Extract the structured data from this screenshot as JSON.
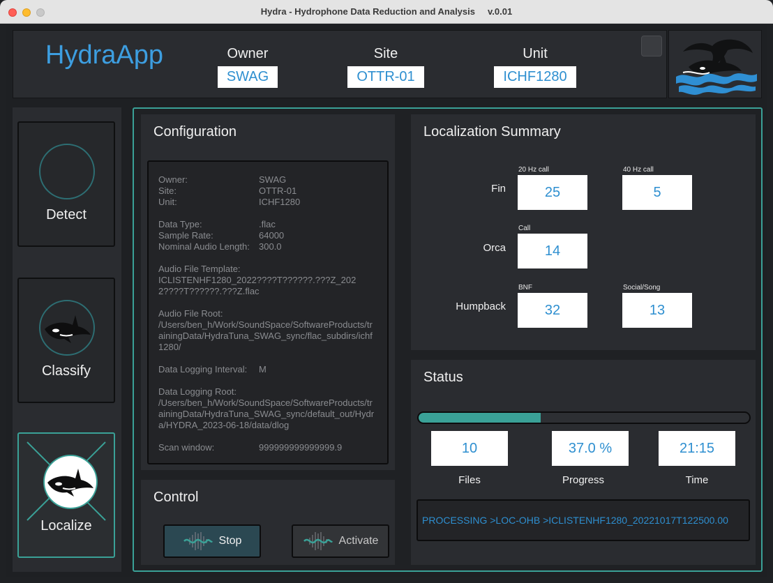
{
  "window": {
    "title": "Hydra - Hydrophone Data Reduction and Analysis     v.0.01"
  },
  "header": {
    "app_name": "HydraApp",
    "owner_label": "Owner",
    "owner_value": "SWAG",
    "site_label": "Site",
    "site_value": "OTTR-01",
    "unit_label": "Unit",
    "unit_value": "ICHF1280"
  },
  "sidebar": {
    "detect": "Detect",
    "classify": "Classify",
    "localize": "Localize"
  },
  "config": {
    "title": "Configuration",
    "owner_k": "Owner:",
    "owner_v": "SWAG",
    "site_k": "Site:",
    "site_v": "OTTR-01",
    "unit_k": "Unit:",
    "unit_v": "ICHF1280",
    "dtype_k": "Data Type:",
    "dtype_v": ".flac",
    "srate_k": "Sample Rate:",
    "srate_v": "64000",
    "alen_k": "Nominal Audio Length:",
    "alen_v": "300.0",
    "template_k": "Audio File Template:",
    "template_v": "ICLISTENHF1280_2022????T??????.???Z_2022????T??????.???Z.flac",
    "root_k": "Audio File Root:",
    "root_v": "/Users/ben_h/Work/SoundSpace/SoftwareProducts/trainingData/HydraTuna_SWAG_sync/flac_subdirs/ichf1280/",
    "interval_k": "Data Logging Interval:",
    "interval_v": "M",
    "logroot_k": "Data Logging Root:",
    "logroot_v": "/Users/ben_h/Work/SoundSpace/SoftwareProducts/trainingData/HydraTuna_SWAG_sync/default_out/Hydra/HYDRA_2023-06-18/data/dlog",
    "scan_k": "Scan window:",
    "scan_v": "999999999999999.9"
  },
  "control": {
    "title": "Control",
    "stop": "Stop",
    "activate": "Activate"
  },
  "localization": {
    "title": "Localization Summary",
    "fin_label": "Fin",
    "fin_20_sub": "20 Hz call",
    "fin_20": "25",
    "fin_40_sub": "40 Hz call",
    "fin_40": "5",
    "orca_label": "Orca",
    "orca_sub": "Call",
    "orca": "14",
    "hump_label": "Humpback",
    "hump_bnf_sub": "BNF",
    "hump_bnf": "32",
    "hump_song_sub": "Social/Song",
    "hump_song": "13"
  },
  "status": {
    "title": "Status",
    "progress_fraction": 0.37,
    "files": "10",
    "files_label": "Files",
    "progress": "37.0 %",
    "progress_label": "Progress",
    "time": "21:15",
    "time_label": "Time",
    "log": "PROCESSING >LOC-OHB >ICLISTENHF1280_20221017T122500.00"
  },
  "colors": {
    "accent": "#3aa197",
    "value_text": "#2e8fd0",
    "brand": "#3d9ee0"
  }
}
